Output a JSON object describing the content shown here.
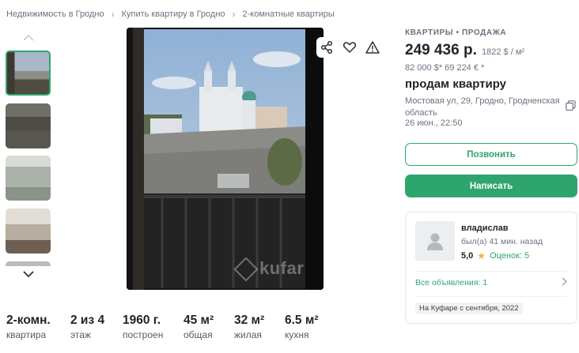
{
  "breadcrumb": [
    "Недвижимость в Гродно",
    "Купить квартиру в Гродно",
    "2-комнатные квартиры"
  ],
  "gallery": {
    "thumbnails": [
      "photo-thumbnail-1",
      "photo-thumbnail-2",
      "photo-thumbnail-3",
      "photo-thumbnail-4",
      "photo-thumbnail-5"
    ],
    "selected_index": 0,
    "watermark": "kufar"
  },
  "icons": {
    "share": "share-icon",
    "favorite": "heart-icon",
    "report": "warning-icon",
    "copy": "copy-icon",
    "up": "chevron-up-icon",
    "down": "chevron-down-icon",
    "star": "star-icon",
    "right": "chevron-right-icon",
    "avatar": "user-avatar-icon"
  },
  "listing": {
    "category": "КВАРТИРЫ • ПРОДАЖА",
    "price": "249 436 р.",
    "price_per_m2": "1822 $ / м²",
    "alt_prices": "82 000 $*  69 224 € *",
    "title": "продам квартиру",
    "address": "Мостовая ул, 29, Гродно, Гродненская область",
    "posted": "26 июн., 22:50"
  },
  "buttons": {
    "call": "Позвонить",
    "message": "Написать"
  },
  "seller": {
    "name": "владислав",
    "last_seen": "был(а) 41 мин. назад",
    "rating": "5,0",
    "star": "★",
    "reviews": "Оценок: 5",
    "all_listings": "Все объявления: 1",
    "since": "На Куфаре с сентября, 2022"
  },
  "specs": [
    {
      "value": "2-комн.",
      "label": "квартира"
    },
    {
      "value": "2 из 4",
      "label": "этаж"
    },
    {
      "value": "1960 г.",
      "label": "построен"
    },
    {
      "value": "45 м²",
      "label": "общая"
    },
    {
      "value": "32 м²",
      "label": "жилая"
    },
    {
      "value": "6.5 м²",
      "label": "кухня"
    }
  ],
  "colors": {
    "accent": "#2fa56e",
    "text": "#1f2329",
    "muted": "#6b7280",
    "star": "#f6b526"
  }
}
